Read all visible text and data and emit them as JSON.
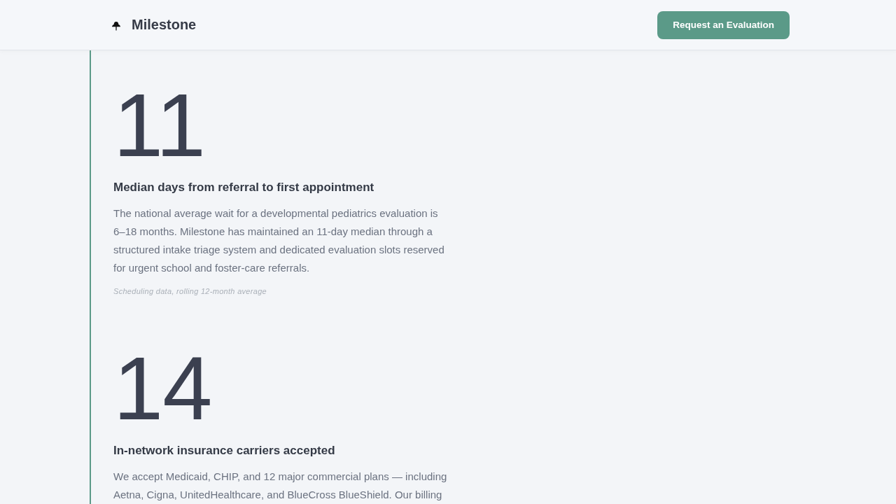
{
  "header": {
    "brand": "Milestone",
    "cta": "Request an Evaluation"
  },
  "stats": [
    {
      "value": "11",
      "title": "Median days from referral to first appointment",
      "description": "The national average wait for a developmental pediatrics evaluation is 6–18 months. Milestone has maintained an 11-day median through a structured intake triage system and dedicated evaluation slots reserved for urgent school and foster-care referrals.",
      "source": "Scheduling data, rolling 12-month average"
    },
    {
      "value": "14",
      "title": "In-network insurance carriers accepted",
      "description": "We accept Medicaid, CHIP, and 12 major commercial plans — including Aetna, Cigna, UnitedHealthcare, and BlueCross BlueShield. Our billing"
    }
  ]
}
